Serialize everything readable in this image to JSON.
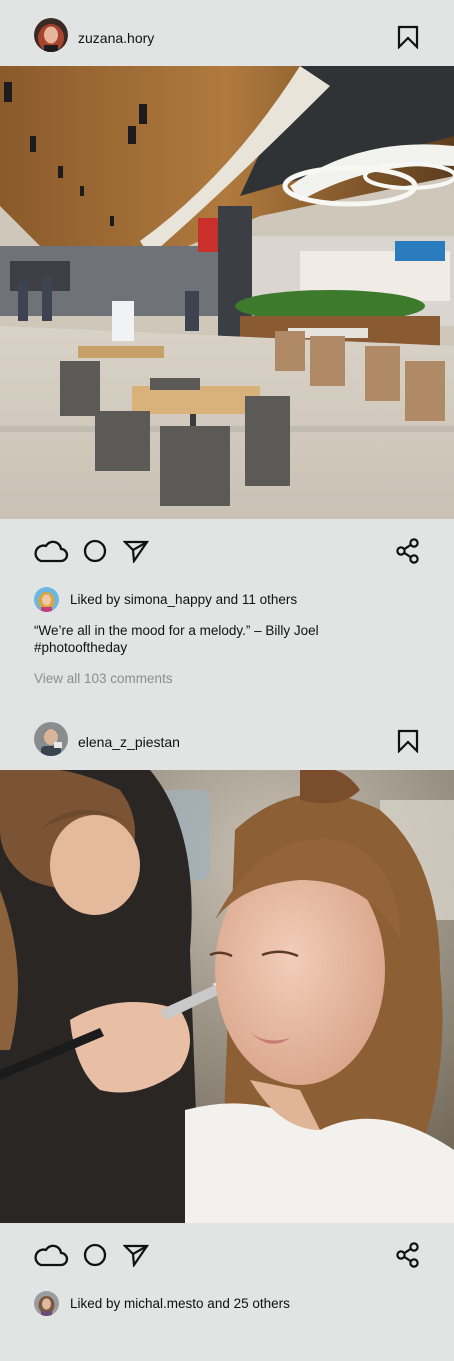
{
  "posts": [
    {
      "username": "zuzana.hory",
      "avatar_icon": "user-avatar-red-hair",
      "photo_description_icon": "food-court-photo",
      "likes_text": "Liked by simona_happy and 11 others",
      "caption_line1": "“We’re all in the mood for a melody.” – Billy Joel",
      "caption_line2": "#photooftheday",
      "view_comments": "View all 103 comments"
    },
    {
      "username": "elena_z_piestan",
      "avatar_icon": "user-avatar-man",
      "photo_description_icon": "makeup-artist-photo",
      "likes_text": "Liked by michal.mesto and 25 others"
    }
  ],
  "icons": {
    "like": "cloud-icon",
    "comment": "circle-icon",
    "send": "send-arrow-icon",
    "share": "share-icon",
    "save": "bookmark-icon"
  },
  "colors": {
    "background": "#e1e4e3",
    "text": "#111111",
    "muted_text": "#8b8e8e"
  }
}
